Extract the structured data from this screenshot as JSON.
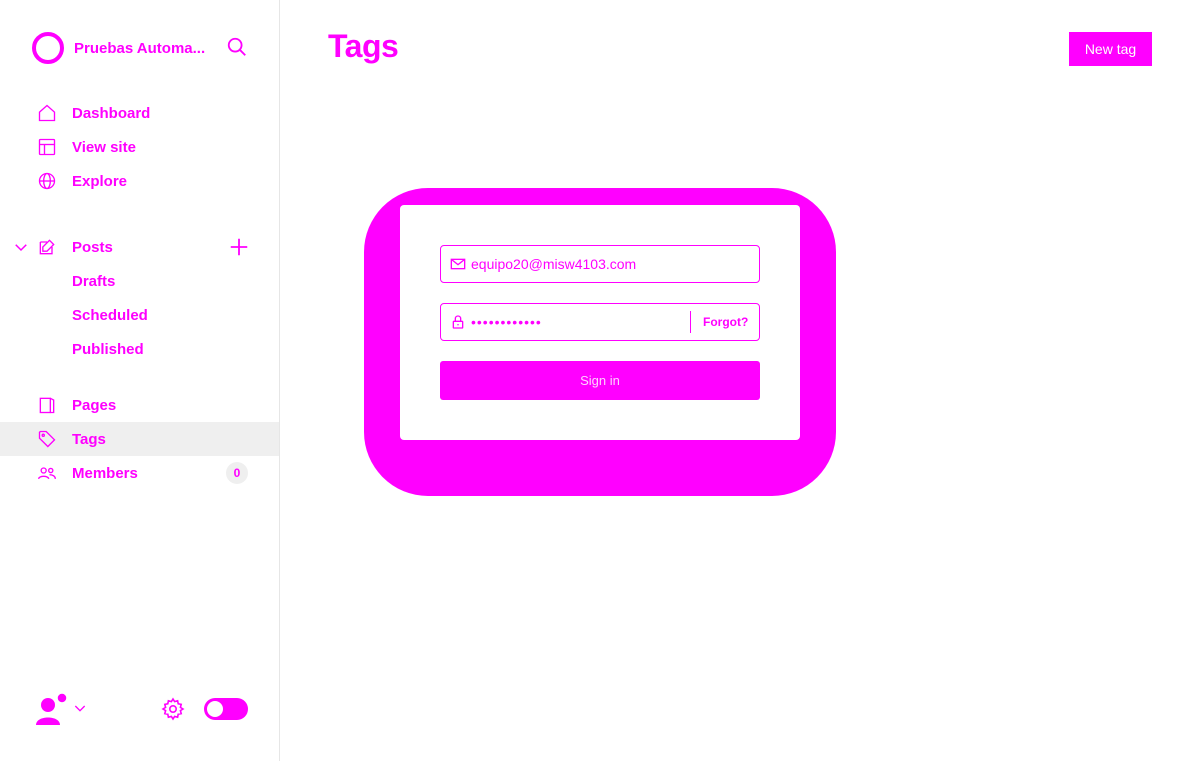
{
  "sidebar": {
    "brand_name": "Pruebas Automa...",
    "search_icon": "search-icon",
    "nav": {
      "dashboard": "Dashboard",
      "view_site": "View site",
      "explore": "Explore",
      "posts": "Posts",
      "drafts": "Drafts",
      "scheduled": "Scheduled",
      "published": "Published",
      "pages": "Pages",
      "tags": "Tags",
      "members": "Members",
      "members_count": "0"
    },
    "active_item": "Tags"
  },
  "header": {
    "title": "Tags",
    "new_tag_label": "New tag"
  },
  "signin": {
    "email_value": "equipo20@misw4103.com",
    "password_value": "••••••••••••",
    "forgot_label": "Forgot?",
    "signin_label": "Sign in"
  },
  "colors": {
    "accent": "#ff00ff",
    "active_bg": "#efefef",
    "background": "#ffffff"
  }
}
